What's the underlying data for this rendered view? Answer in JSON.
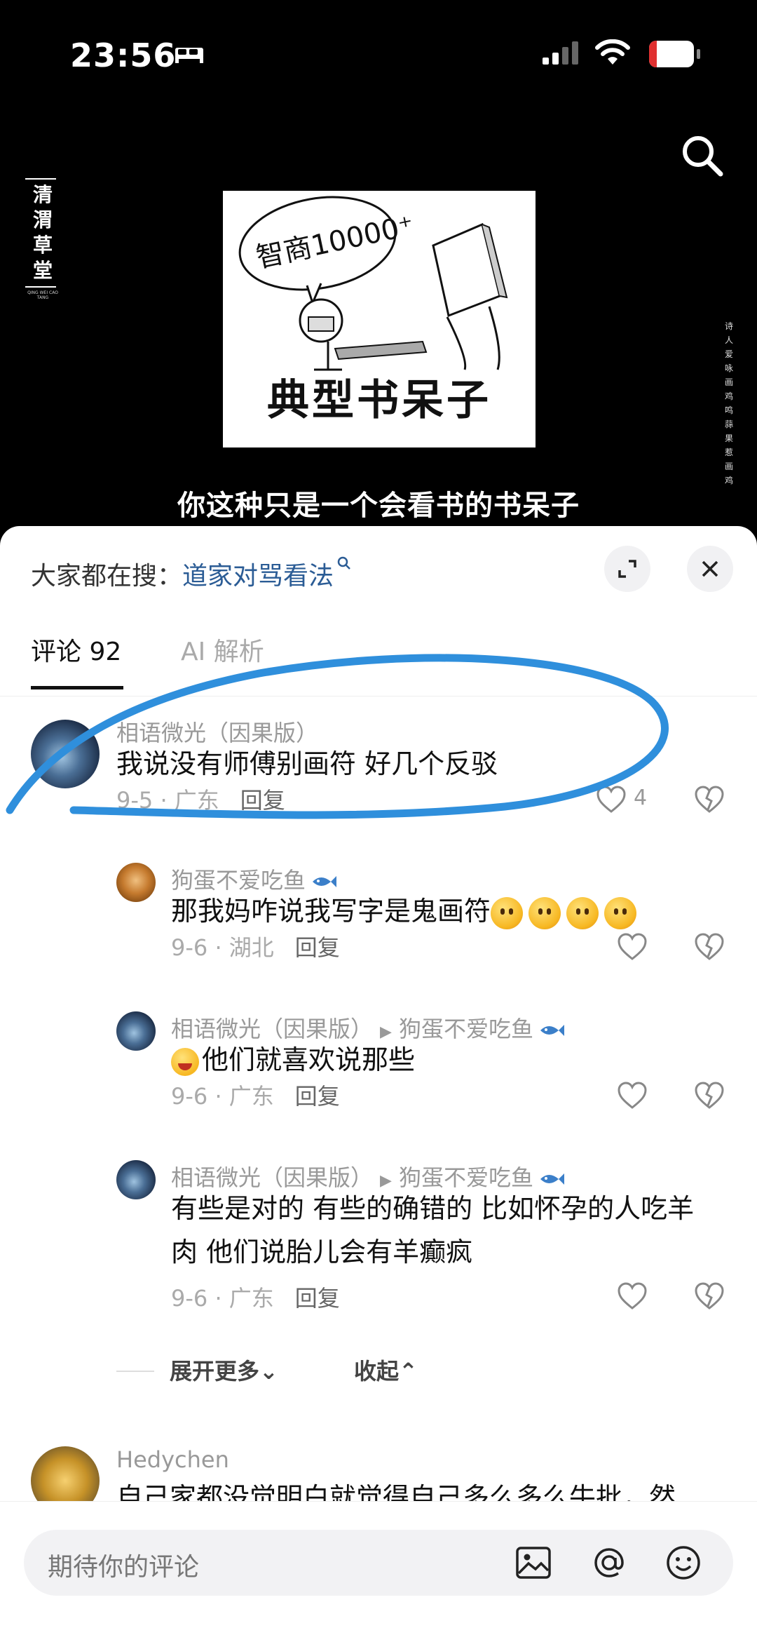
{
  "status_bar": {
    "time": "23:56",
    "battery": "17",
    "battery_level": 0.17
  },
  "video": {
    "logo_chars": [
      "清",
      "渭",
      "草",
      "堂"
    ],
    "logo_small_text": "QING WEI CAO TANG",
    "meme_bubble": "智商10000⁺",
    "meme_caption": "典型书呆子",
    "side_poem": "诗人爱咏画鸡鸣蒜果惹画鸡",
    "subtitle": "你这种只是一个会看书的书呆子"
  },
  "panel": {
    "hot_search_prefix": "大家都在搜：",
    "hot_search_link": "道家对骂看法",
    "tabs": {
      "comments": "评论 92",
      "ai": "AI 解析"
    }
  },
  "comments": {
    "c1": {
      "name": "相语微光（因果版）",
      "text": "我说没有师傅别画符 好几个反驳",
      "date_loc": "9-5 · 广东",
      "reply": "回复",
      "likes": "4"
    },
    "r1": {
      "name": "狗蛋不爱吃鱼",
      "text": "那我妈咋说我写字是鬼画符",
      "date_loc": "9-6 · 湖北",
      "reply": "回复"
    },
    "r2": {
      "name": "相语微光（因果版）",
      "reply_to": "狗蛋不爱吃鱼",
      "text": "他们就喜欢说那些",
      "date_loc": "9-6 · 广东",
      "reply": "回复"
    },
    "r3": {
      "name": "相语微光（因果版）",
      "reply_to": "狗蛋不爱吃鱼",
      "text_line1": "有些是对的 有些的确错的 比如怀孕的人吃羊",
      "text_line2": "肉 他们说胎儿会有羊癫疯",
      "date_loc": "9-6 · 广东",
      "reply": "回复"
    },
    "expand_more": "展开更多⌄",
    "collapse": "收起⌃",
    "c2": {
      "name": "Hedychen",
      "text": "自己家都没觉明白就觉得自己多么多么牛批，然"
    }
  },
  "input": {
    "placeholder": "期待你的评论"
  },
  "colors": {
    "annotation_blue": "#2f8fdc",
    "link_blue": "#2b5c95"
  }
}
